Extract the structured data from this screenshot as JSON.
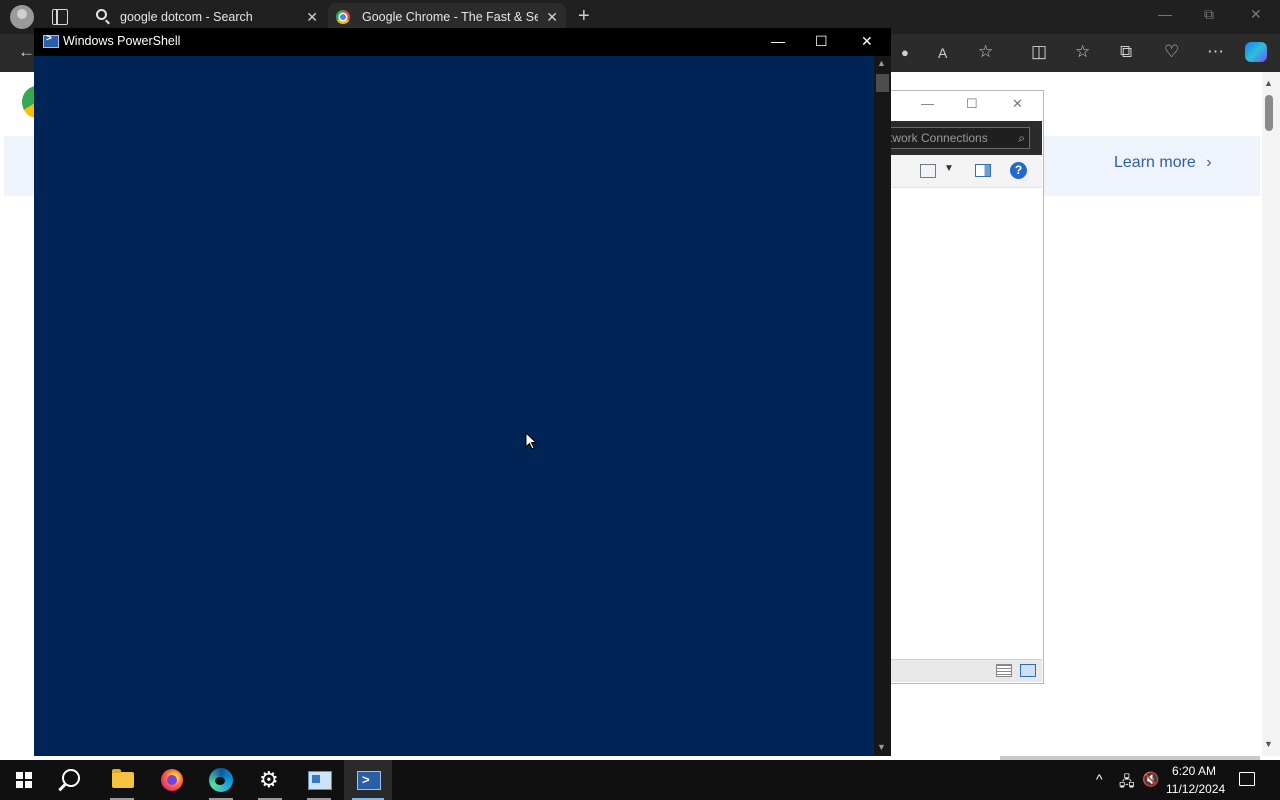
{
  "browser": {
    "tabs": [
      {
        "title": "google dotcom - Search",
        "icon": "search-icon",
        "active": false
      },
      {
        "title": "Google Chrome - The Fast & Sec",
        "icon": "chrome-icon",
        "active": true
      }
    ],
    "new_tab_symbol": "+",
    "close_symbol": "✕",
    "window_controls": {
      "minimize": "—",
      "restore": "⧉",
      "close": "✕"
    },
    "toolbar_icons": [
      "back-icon",
      "location-icon",
      "read-aloud-icon",
      "favorite-icon",
      "split-screen-icon",
      "favorites-icon",
      "collections-icon",
      "performance-icon",
      "more-icon",
      "copilot-icon"
    ],
    "page": {
      "learn_more": "Learn more",
      "learn_more_chevron": "›"
    }
  },
  "network_window": {
    "search_placeholder": "twork Connections",
    "help_symbol": "?"
  },
  "powershell": {
    "title": "Windows PowerShell",
    "window_controls": {
      "minimize": "—",
      "maximize": "☐",
      "close": "✕"
    },
    "background_color": "#012456"
  },
  "taskbar": {
    "apps": [
      "start-icon",
      "search-icon",
      "file-explorer-icon",
      "firefox-icon",
      "edge-icon",
      "settings-icon",
      "network-connections-icon",
      "powershell-icon"
    ],
    "tray": {
      "chevron": "^",
      "time": "6:20 AM",
      "date": "11/12/2024"
    }
  }
}
